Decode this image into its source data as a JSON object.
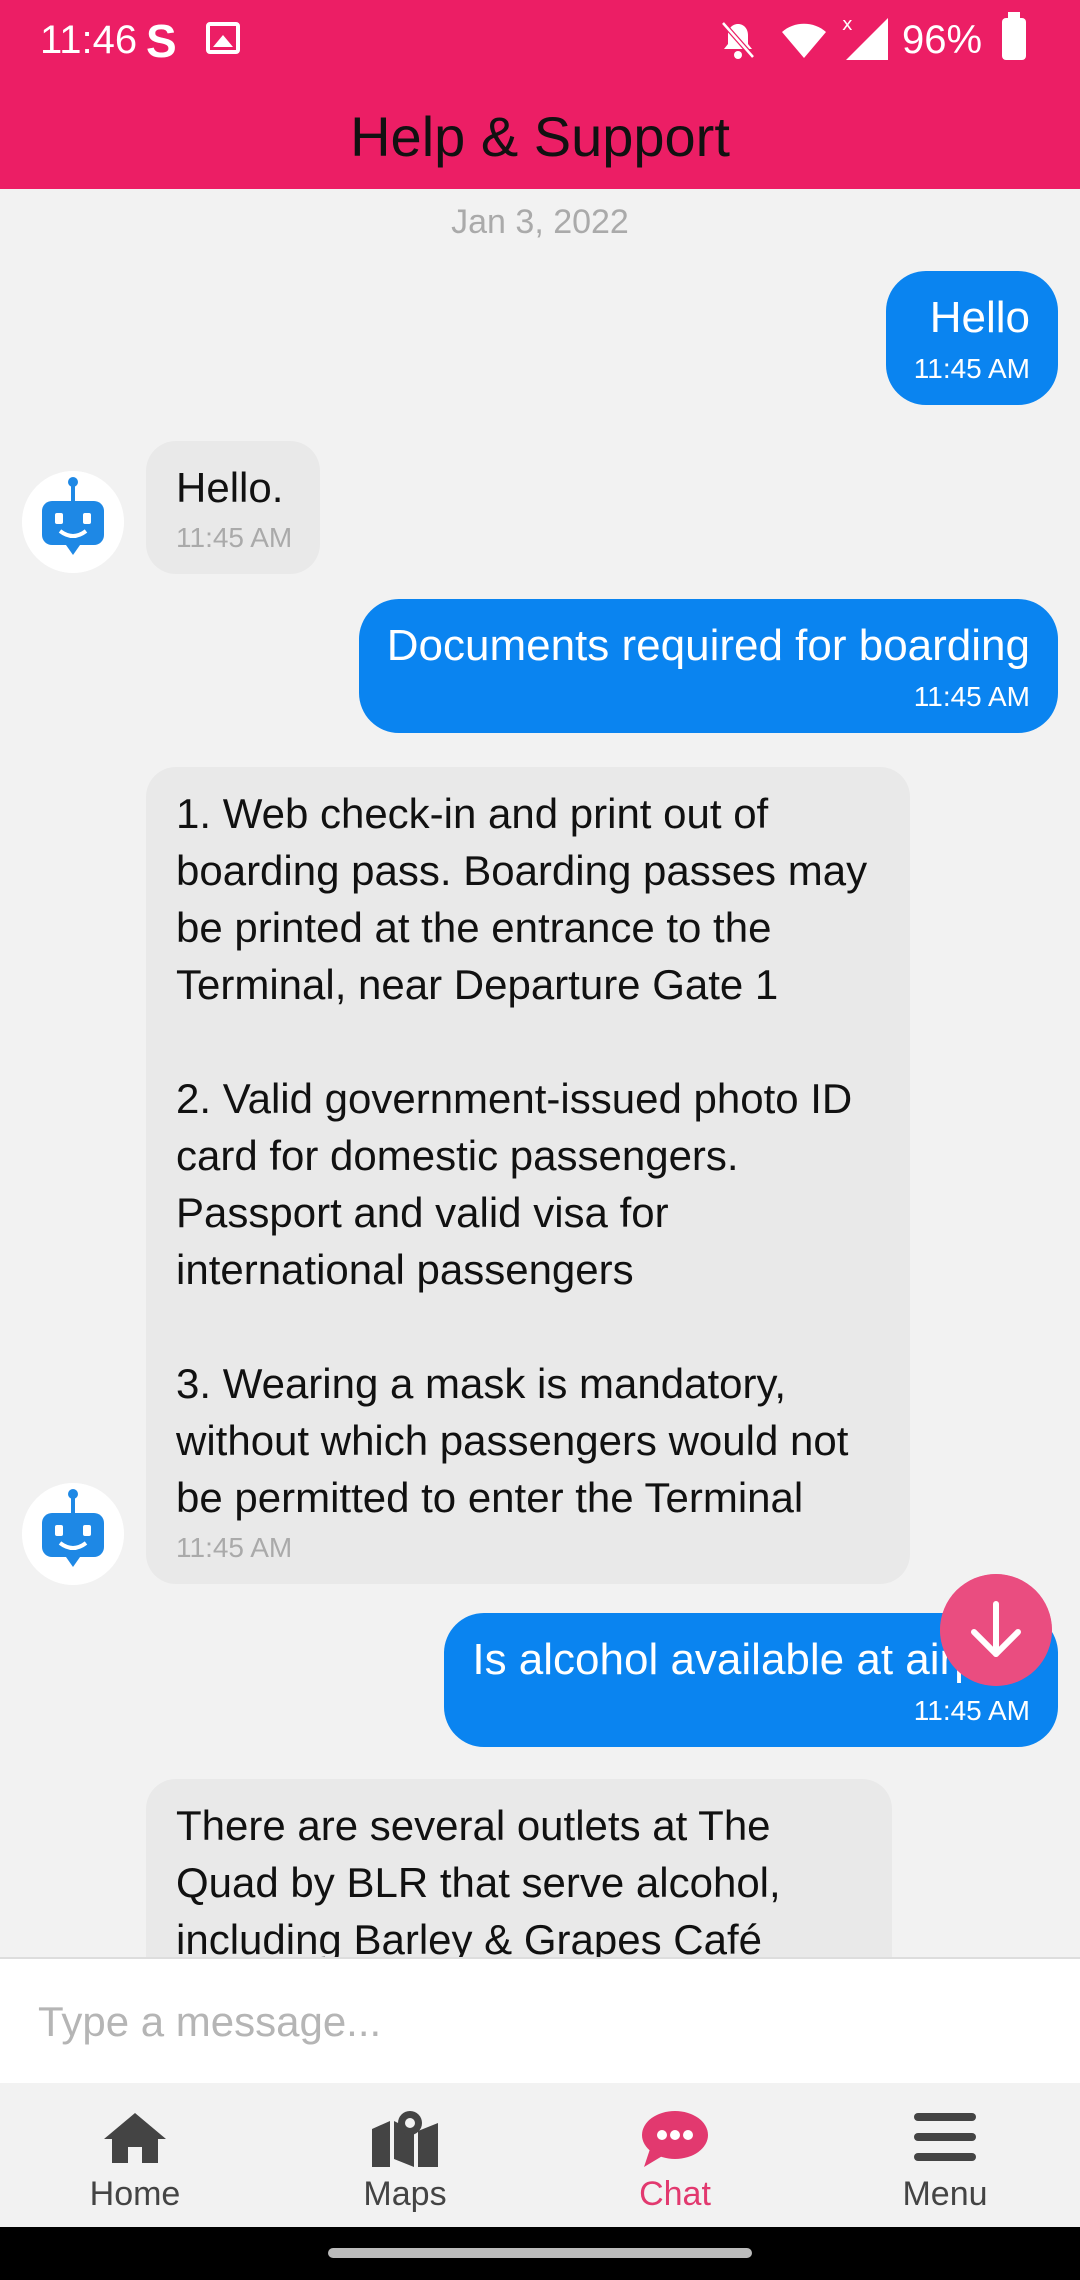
{
  "status": {
    "time": "11:46",
    "battery": "96%",
    "icons": [
      "s-app-icon",
      "image-icon",
      "do-not-disturb-bell-icon",
      "wifi-icon",
      "signal-icon",
      "battery-icon"
    ]
  },
  "header": {
    "title": "Help & Support"
  },
  "chat": {
    "date": "Jan 3, 2022",
    "messages": [
      {
        "from": "user",
        "text": "Hello",
        "time": "11:45 AM"
      },
      {
        "from": "bot",
        "text": "Hello.",
        "time": "11:45 AM"
      },
      {
        "from": "user",
        "text": "Documents required for boarding",
        "time": "11:45 AM"
      },
      {
        "from": "bot",
        "text": "1. Web check-in and print out of boarding pass. Boarding passes may be printed at the entrance to the Terminal, near Departure Gate 1\n\n2. Valid government-issued photo ID card for domestic passengers. Passport and valid visa for international passengers\n\n3. Wearing a mask is mandatory, without which passengers would not be permitted to enter the Terminal",
        "time": "11:45 AM"
      },
      {
        "from": "user",
        "text": "Is alcohol available at airport",
        "time": "11:45 AM"
      },
      {
        "from": "bot",
        "text": "There are several outlets at The Quad by BLR that serve alcohol, including Barley & Grapes Café",
        "time": ""
      }
    ]
  },
  "input": {
    "placeholder": "Type a message..."
  },
  "nav": {
    "items": [
      {
        "label": "Home",
        "icon": "home-icon"
      },
      {
        "label": "Maps",
        "icon": "map-icon"
      },
      {
        "label": "Chat",
        "icon": "chat-icon",
        "active": true
      },
      {
        "label": "Menu",
        "icon": "menu-icon"
      }
    ]
  },
  "colors": {
    "brand": "#ec1e65",
    "bubble_out": "#0a84f0",
    "bubble_in": "#e9e9e9",
    "fab": "#ea4d80",
    "bot_icon": "#1e88e5"
  }
}
